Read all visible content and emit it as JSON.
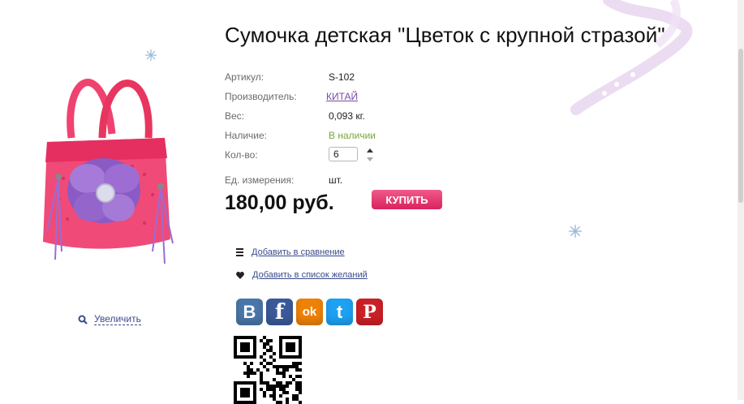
{
  "product": {
    "title": "Сумочка детская \"Цветок с крупной стразой\"",
    "image_alt": "Сумочка детская розовая с фиолетовым цветком",
    "zoom_label": "Увеличить"
  },
  "specs": {
    "article_label": "Артикул:",
    "article_value": "S-102",
    "manufacturer_label": "Производитель:",
    "manufacturer_value": "КИТАЙ",
    "weight_label": "Вес:",
    "weight_value": "0,093 кг.",
    "availability_label": "Наличие:",
    "availability_value": "В наличии",
    "quantity_label": "Кол-во:",
    "quantity_value": "6",
    "unit_label": "Ед. измерения:",
    "unit_value": "шт."
  },
  "price": "180,00 руб.",
  "buy_label": "КУПИТЬ",
  "actions": {
    "compare_label": "Добавить в сравнение",
    "wishlist_label": "Добавить в список желаний"
  },
  "social": [
    {
      "name": "vk",
      "glyph": "В",
      "color": "#4a76a8"
    },
    {
      "name": "facebook",
      "glyph": "f",
      "color": "#3b5998"
    },
    {
      "name": "odnoklassniki",
      "glyph": "ok",
      "color": "#ee8208"
    },
    {
      "name": "twitter",
      "glyph": "t",
      "color": "#1da1f2"
    },
    {
      "name": "pinterest",
      "glyph": "P",
      "color": "#cb2027"
    }
  ],
  "colors": {
    "buy_button": "#e0306a",
    "link": "#3a4b8a",
    "manufacturer_link": "#7a4aa0",
    "in_stock": "#7aa53a"
  }
}
